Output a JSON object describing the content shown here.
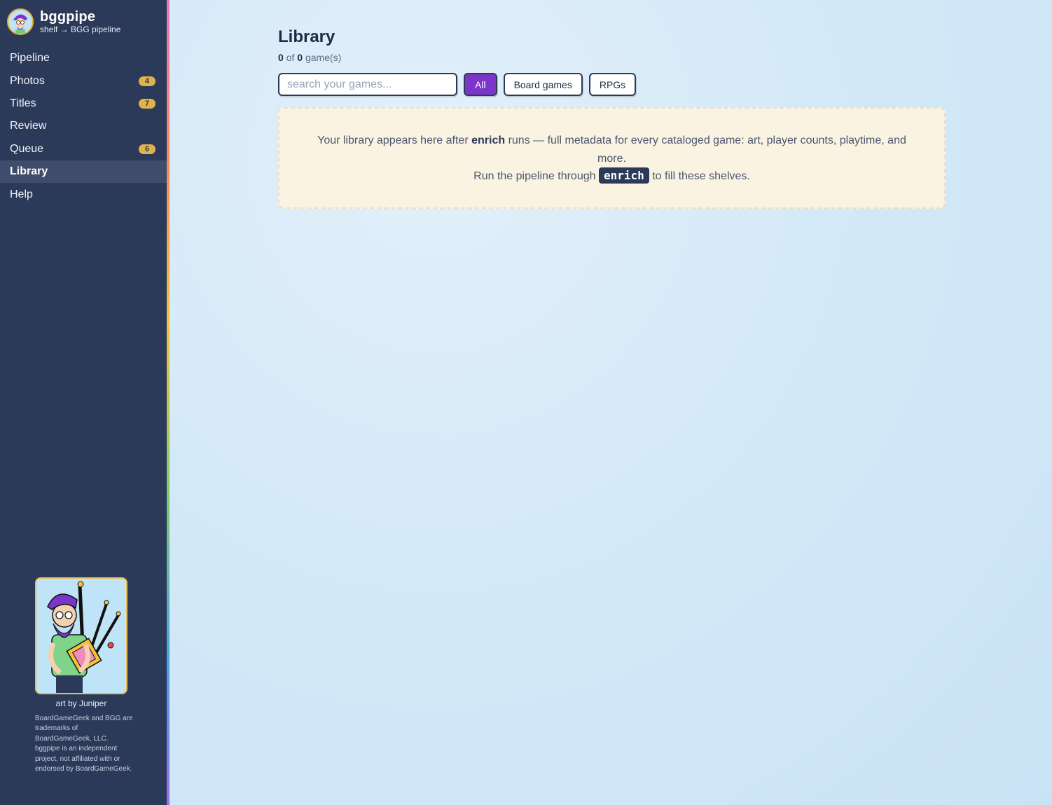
{
  "brand": {
    "name": "bggpipe",
    "subtitle": "shelf → BGG pipeline"
  },
  "sidebar": {
    "items": [
      {
        "label": "Pipeline",
        "badge": ""
      },
      {
        "label": "Photos",
        "badge": "4"
      },
      {
        "label": "Titles",
        "badge": "7"
      },
      {
        "label": "Review",
        "badge": ""
      },
      {
        "label": "Queue",
        "badge": "6"
      },
      {
        "label": "Library",
        "badge": "",
        "active": true
      },
      {
        "label": "Help",
        "badge": ""
      }
    ],
    "credit": "art by Juniper",
    "legal": "BoardGameGeek and BGG are trademarks of BoardGameGeek, LLC. bggpipe is an independent project, not affiliated with or endorsed by BoardGameGeek."
  },
  "main": {
    "title": "Library",
    "count_shown": "0",
    "count_of": "of",
    "count_total": "0",
    "count_suffix": "game(s)",
    "search": {
      "placeholder": "search your games...",
      "value": ""
    },
    "filters": [
      "All",
      "Board games",
      "RPGs"
    ],
    "empty": {
      "line1_pre": "Your library appears here after",
      "line1_bold": "enrich",
      "line1_post": "runs — full metadata for every cataloged game: art, player counts, playtime, and more.",
      "line2_pre": "Run the pipeline through",
      "line2_code": "enrich",
      "line2_post": "to fill these shelves."
    }
  },
  "colors": {
    "sidebar_bg": "#2c3a5a",
    "accent": "#7b35c9",
    "badge": "#e0b24a",
    "empty_bg": "#fbf3e2"
  }
}
